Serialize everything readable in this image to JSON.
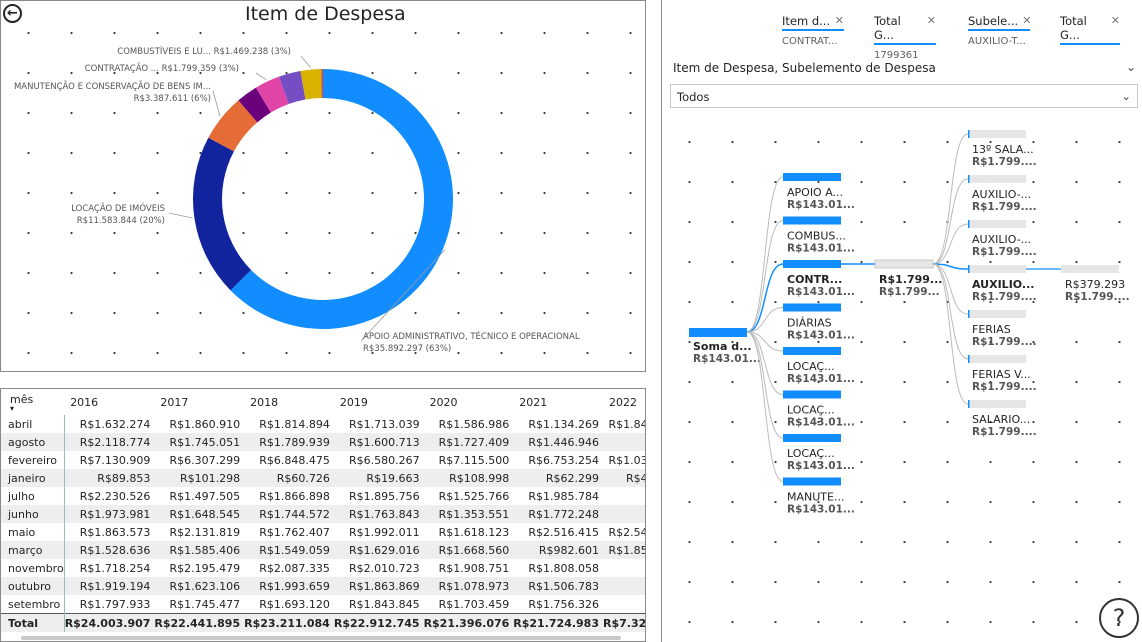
{
  "donut": {
    "title": "Item de Despesa",
    "back_icon": "back-arrow-icon",
    "chart_data": {
      "type": "pie",
      "title": "Item de Despesa",
      "slices": [
        {
          "name": "APOIO ADMINISTRATIVO, TÉCNICO E OPERACIONAL",
          "label": "APOIO ADMINISTRATIVO, TÉCNICO E OPERACIONAL",
          "value_label": "R$35.892.297 (63%)",
          "value": 35892297,
          "color": "#118dff"
        },
        {
          "name": "LOCAÇÃO DE IMÓVEIS",
          "label": "LOCAÇÃO DE IMÓVEIS",
          "value_label": "R$11.583.844 (20%)",
          "value": 11583844,
          "color": "#12239e"
        },
        {
          "name": "MANUTENÇÃO E CONSERVAÇÃO DE BENS IM...",
          "label": "MANUTENÇÃO E CONSERVAÇÃO DE BENS IM...",
          "value_label": "R$3.387.611 (6%)",
          "value": 3387611,
          "color": "#e66c37"
        },
        {
          "name": "slice-4",
          "label": "",
          "value_label": "",
          "value": 1520000,
          "color": "#6b007b"
        },
        {
          "name": "CONTRATAÇÃO ...",
          "label": "CONTRATAÇÃO ...",
          "value_label": "R$1.799.359 (3%)",
          "value": 1799359,
          "color": "#e044a7"
        },
        {
          "name": "slice-6",
          "label": "",
          "value_label": "",
          "value": 1560000,
          "color": "#744ec2"
        },
        {
          "name": "COMBUSTÍVEIS E LU...",
          "label": "COMBUSTÍVEIS E LU...",
          "value_label": "R$1.469.238 (3%)",
          "value": 1469238,
          "color": "#d9b300"
        },
        {
          "name": "slice-8",
          "label": "",
          "value_label": "",
          "value": 120000,
          "color": "#d64550"
        }
      ]
    }
  },
  "table": {
    "header_month": "mês",
    "years": [
      "2016",
      "2017",
      "2018",
      "2019",
      "2020",
      "2021",
      "2022"
    ],
    "rows": [
      {
        "month": "abril",
        "values": [
          "R$1.632.274",
          "R$1.860.910",
          "R$1.814.894",
          "R$1.713.039",
          "R$1.586.986",
          "R$1.134.269",
          "R$1.844."
        ]
      },
      {
        "month": "agosto",
        "values": [
          "R$2.118.774",
          "R$1.745.051",
          "R$1.789.939",
          "R$1.600.713",
          "R$1.727.409",
          "R$1.446.946",
          ""
        ]
      },
      {
        "month": "fevereiro",
        "values": [
          "R$7.130.909",
          "R$6.307.299",
          "R$6.848.475",
          "R$6.580.267",
          "R$7.115.500",
          "R$6.753.254",
          "R$1.035."
        ]
      },
      {
        "month": "janeiro",
        "values": [
          "R$89.853",
          "R$101.298",
          "R$60.726",
          "R$19.663",
          "R$108.998",
          "R$62.299",
          "R$43."
        ]
      },
      {
        "month": "julho",
        "values": [
          "R$2.230.526",
          "R$1.497.505",
          "R$1.866.898",
          "R$1.895.756",
          "R$1.525.766",
          "R$1.985.784",
          ""
        ]
      },
      {
        "month": "junho",
        "values": [
          "R$1.973.981",
          "R$1.648.545",
          "R$1.744.572",
          "R$1.763.843",
          "R$1.353.551",
          "R$1.772.248",
          ""
        ]
      },
      {
        "month": "maio",
        "values": [
          "R$1.863.573",
          "R$2.131.819",
          "R$1.762.407",
          "R$1.992.011",
          "R$1.618.123",
          "R$2.516.415",
          "R$2.547."
        ]
      },
      {
        "month": "março",
        "values": [
          "R$1.528.636",
          "R$1.585.406",
          "R$1.549.059",
          "R$1.629.016",
          "R$1.668.560",
          "R$982.601",
          "R$1.852."
        ]
      },
      {
        "month": "novembro",
        "values": [
          "R$1.718.254",
          "R$2.195.479",
          "R$2.087.335",
          "R$2.010.723",
          "R$1.908.751",
          "R$1.808.058",
          ""
        ]
      },
      {
        "month": "outubro",
        "values": [
          "R$1.919.194",
          "R$1.623.106",
          "R$1.993.659",
          "R$1.863.869",
          "R$1.078.973",
          "R$1.506.783",
          ""
        ]
      },
      {
        "month": "setembro",
        "values": [
          "R$1.797.933",
          "R$1.745.477",
          "R$1.693.120",
          "R$1.843.845",
          "R$1.703.459",
          "R$1.756.326",
          ""
        ]
      }
    ],
    "total": {
      "month": "Total",
      "values": [
        "R$24.003.907",
        "R$22.441.895",
        "R$23.211.084",
        "R$22.912.745",
        "R$21.396.076",
        "R$21.724.983",
        "R$7.322."
      ]
    }
  },
  "filters": [
    {
      "name": "Item d...",
      "value": "CONTRAT..."
    },
    {
      "name": "Total G...",
      "value": "1799361"
    },
    {
      "name": "Subele...",
      "value": "AUXILIO-T..."
    },
    {
      "name": "Total G...",
      "value": ""
    }
  ],
  "dropdown": {
    "title": "Item de Despesa, Subelemento de Despesa",
    "value": "Todos"
  },
  "tree": {
    "root": {
      "label": "Soma d...",
      "value": "R$143.01..."
    },
    "level1": [
      {
        "label": "APOIO A...",
        "value": "R$143.01...",
        "fill": 1
      },
      {
        "label": "COMBUS...",
        "value": "R$143.01...",
        "fill": 1
      },
      {
        "label": "CONTR...",
        "value": "R$143.01...",
        "fill": 1,
        "selected": true
      },
      {
        "label": "DIÁRIAS",
        "value": "R$143.01...",
        "fill": 1
      },
      {
        "label": "LOCAÇ...",
        "value": "R$143.01...",
        "fill": 1
      },
      {
        "label": "LOCAÇ...",
        "value": "R$143.01...",
        "fill": 1
      },
      {
        "label": "LOCAÇ...",
        "value": "R$143.01...",
        "fill": 1
      },
      {
        "label": "MANUTE...",
        "value": "R$143.01...",
        "fill": 1
      }
    ],
    "level2": {
      "label": "R$1.799...",
      "value": "R$1.799..."
    },
    "level3": [
      {
        "label": "13º SALA...",
        "value": "R$1.799...."
      },
      {
        "label": "AUXILIO-...",
        "value": "R$1.799...."
      },
      {
        "label": "AUXILIO-...",
        "value": "R$1.799...."
      },
      {
        "label": "AUXILIO...",
        "value": "R$1.799....",
        "selected": true
      },
      {
        "label": "FERIAS",
        "value": "R$1.799...."
      },
      {
        "label": "FERIAS V...",
        "value": "R$1.799...."
      },
      {
        "label": "SALARIO...",
        "value": "R$1.799...."
      }
    ],
    "level4": {
      "label": "R$379.293",
      "value": "R$1.799...."
    }
  },
  "help": "?"
}
